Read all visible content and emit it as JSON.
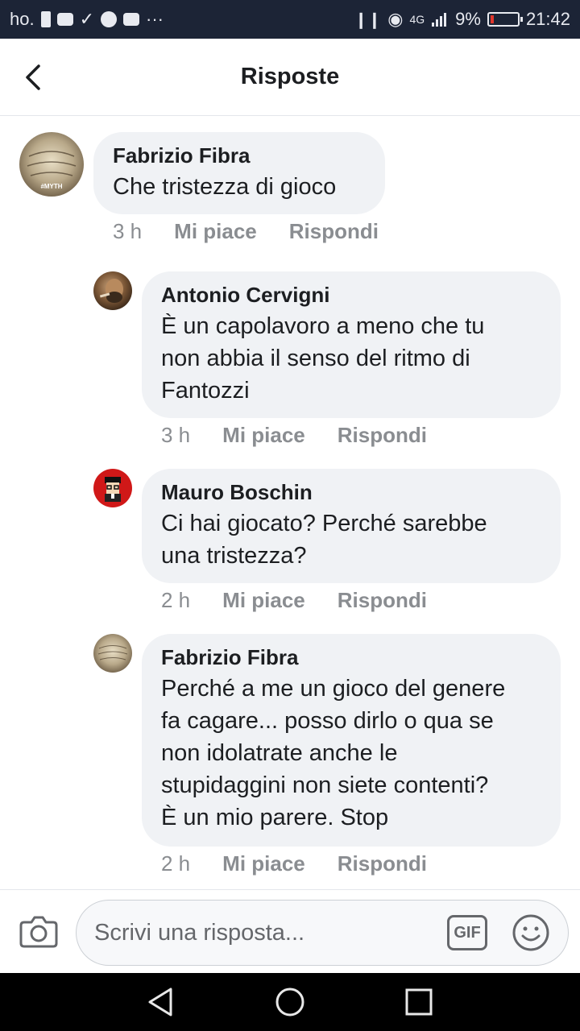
{
  "status_bar": {
    "carrier": "ho.",
    "network": "4G",
    "battery": "9%",
    "battery_level": 0.09,
    "time": "21:42"
  },
  "header": {
    "title": "Risposte",
    "back_icon": "back-arrow-icon"
  },
  "comments": [
    {
      "author": "Fabrizio Fibra",
      "text": "Che tristezza di gioco",
      "time": "3 h",
      "like_label": "Mi piace",
      "reply_label": "Rispondi",
      "avatar_text": "#MYTH"
    },
    {
      "author": "Antonio Cervigni",
      "text_lines": [
        "È un capolavoro a meno che tu",
        "non abbia il senso del ritmo di",
        "Fantozzi"
      ],
      "time": "3 h",
      "like_label": "Mi piace",
      "reply_label": "Rispondi"
    },
    {
      "author": "Mauro Boschin",
      "text_lines": [
        "Ci hai giocato? Perché sarebbe",
        "una tristezza?"
      ],
      "time": "2 h",
      "like_label": "Mi piace",
      "reply_label": "Rispondi"
    },
    {
      "author": "Fabrizio Fibra",
      "text_lines": [
        "Perché a me un gioco del genere",
        "fa cagare... posso dirlo o qua se",
        "non idolatrate anche le",
        "stupidaggini non siete contenti?",
        "È un mio parere. Stop"
      ],
      "time": "2 h",
      "like_label": "Mi piace",
      "reply_label": "Rispondi"
    }
  ],
  "composer": {
    "placeholder": "Scrivi una risposta...",
    "gif_label": "GIF",
    "camera_icon": "camera-icon",
    "emoji_icon": "emoji-icon"
  },
  "nav_bar": {
    "back_icon": "nav-back-icon",
    "home_icon": "nav-home-icon",
    "recents_icon": "nav-recents-icon"
  },
  "colors": {
    "status_bar_bg": "#1c2436",
    "bubble_bg": "#f0f2f5",
    "text_primary": "#1c1e21",
    "text_secondary": "#8a8d91",
    "battery_low": "#e0362c"
  }
}
